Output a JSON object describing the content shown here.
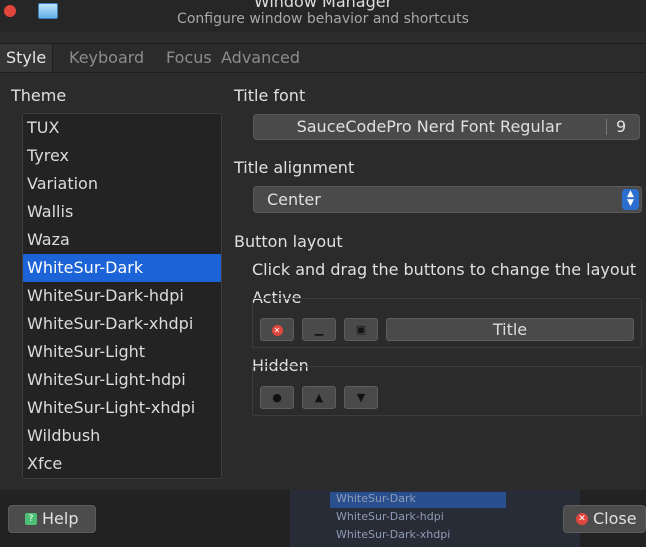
{
  "window": {
    "title": "Window Manager",
    "subtitle": "Configure window behavior and shortcuts"
  },
  "tabs": [
    {
      "label": "Style",
      "active": true
    },
    {
      "label": "Keyboard",
      "active": false
    },
    {
      "label": "Focus",
      "active": false
    },
    {
      "label": "Advanced",
      "active": false
    }
  ],
  "theme": {
    "label": "Theme",
    "items": [
      "TUX",
      "Tyrex",
      "Variation",
      "Wallis",
      "Waza",
      "WhiteSur-Dark",
      "WhiteSur-Dark-hdpi",
      "WhiteSur-Dark-xhdpi",
      "WhiteSur-Light",
      "WhiteSur-Light-hdpi",
      "WhiteSur-Light-xhdpi",
      "Wildbush",
      "Xfce"
    ],
    "selected": "WhiteSur-Dark"
  },
  "title_font": {
    "label": "Title font",
    "font_name": "SauceCodePro Nerd Font Regular",
    "font_size": "9"
  },
  "title_alignment": {
    "label": "Title alignment",
    "value": "Center"
  },
  "button_layout": {
    "label": "Button layout",
    "hint": "Click and drag the buttons to change the layout",
    "active_label": "Active",
    "title_button": "Title",
    "hidden_label": "Hidden"
  },
  "footer": {
    "help_label": "Help",
    "close_label": "Close"
  },
  "background_window_rows": [
    "WhiteSur-Dark",
    "WhiteSur-Dark-hdpi",
    "WhiteSur-Dark-xhdpi"
  ],
  "colors": {
    "accent": "#1b63d6",
    "close": "#e0463c",
    "help": "#4bbf73"
  }
}
